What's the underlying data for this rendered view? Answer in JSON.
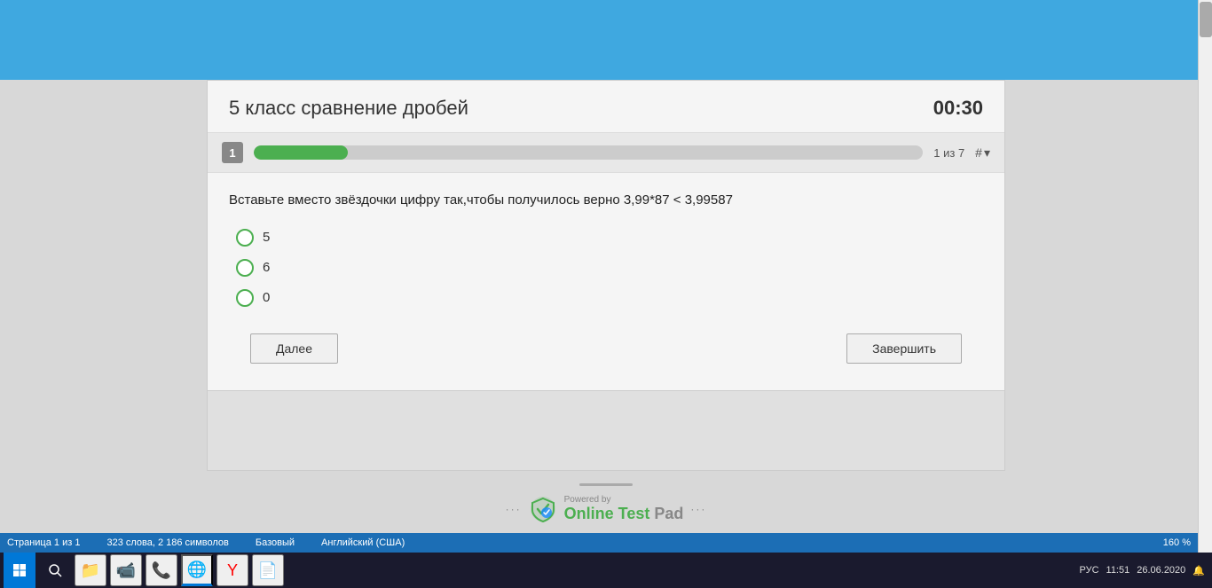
{
  "topBar": {
    "color": "#3fa8e0"
  },
  "quiz": {
    "title": "5 класс сравнение дробей",
    "timer": "00:30",
    "questionNumber": "1",
    "progressText": "1 из 7",
    "progressPercent": 14,
    "questionText": "Вставьте вместо звёздочки цифру так,чтобы получилось верно   3,99*87 < 3,99587",
    "options": [
      {
        "label": "5"
      },
      {
        "label": "6"
      },
      {
        "label": "0"
      }
    ],
    "btnNext": "Далее",
    "btnFinish": "Завершить",
    "hashLabel": "#"
  },
  "footer": {
    "poweredBy": "Powered by",
    "brand": "Online Test Pad",
    "dotsLeft": "···",
    "dotsRight": "···"
  },
  "statusBar": {
    "page": "Страница 1 из 1",
    "wordCount": "323 слова, 2 186 символов",
    "mode": "Базовый",
    "language": "Английский (США)",
    "zoom": "160 %"
  },
  "taskbar": {
    "time": "11:51",
    "date": "26.06.2020",
    "language": "РУС"
  }
}
